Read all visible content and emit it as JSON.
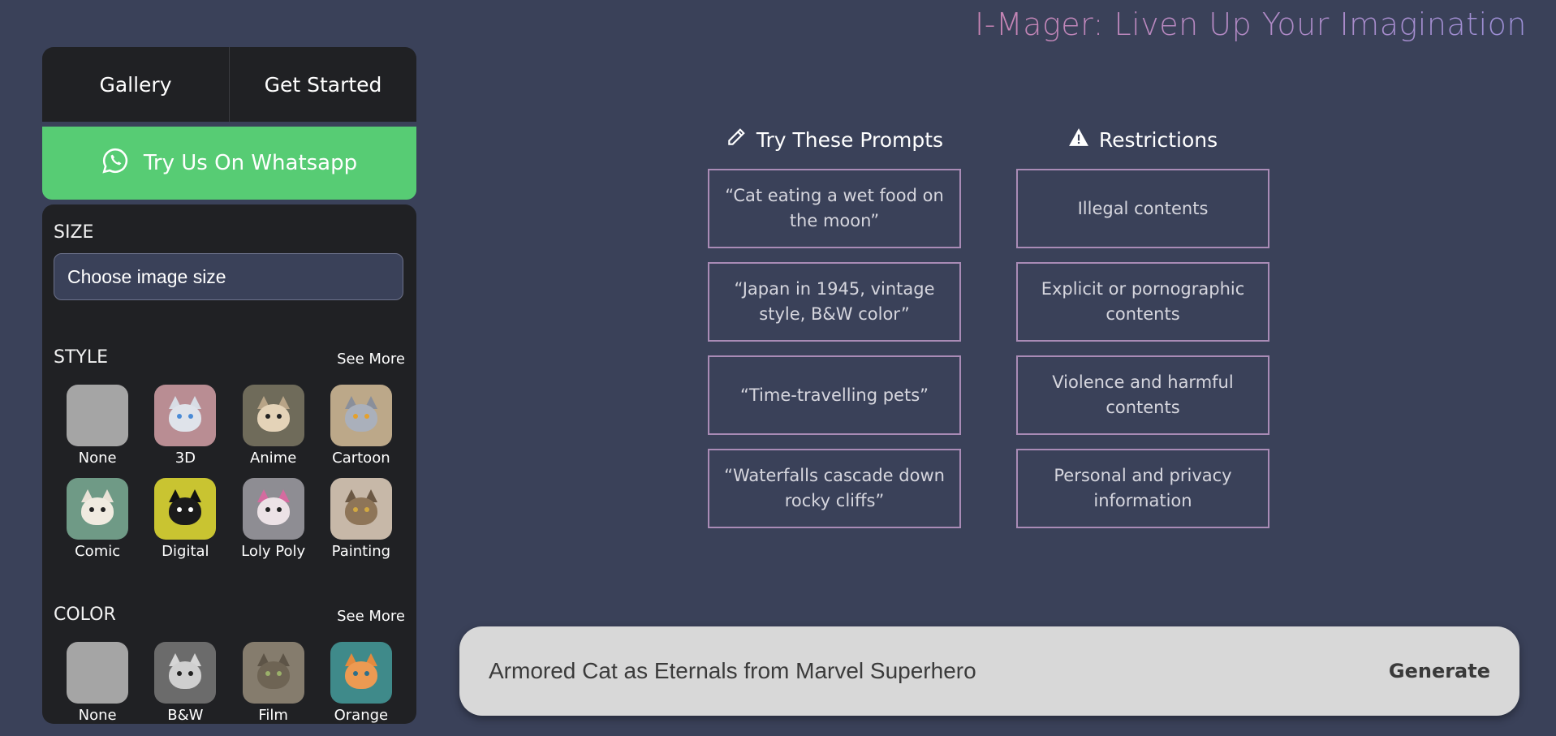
{
  "header": {
    "title": "I-Mager: Liven Up Your Imagination"
  },
  "nav": {
    "gallery": "Gallery",
    "get_started": "Get Started"
  },
  "whatsapp": {
    "label": "Try Us On Whatsapp",
    "color": "#57cc74"
  },
  "size": {
    "label": "SIZE",
    "placeholder": "Choose image size"
  },
  "style": {
    "label": "STYLE",
    "see_more": "See More",
    "items": [
      {
        "label": "None",
        "icon": "blank-thumbnail"
      },
      {
        "label": "3D",
        "icon": "3d-cat-thumbnail"
      },
      {
        "label": "Anime",
        "icon": "anime-cat-thumbnail"
      },
      {
        "label": "Cartoon",
        "icon": "cartoon-cat-thumbnail"
      },
      {
        "label": "Comic",
        "icon": "comic-cat-thumbnail"
      },
      {
        "label": "Digital",
        "icon": "digital-cat-thumbnail"
      },
      {
        "label": "Loly Poly",
        "icon": "loly-poly-cat-thumbnail"
      },
      {
        "label": "Painting",
        "icon": "painting-cat-thumbnail"
      }
    ]
  },
  "color": {
    "label": "COLOR",
    "see_more": "See More",
    "items": [
      {
        "label": "None",
        "icon": "blank-thumbnail"
      },
      {
        "label": "B&W",
        "icon": "bw-cat-thumbnail"
      },
      {
        "label": "Film",
        "icon": "film-cat-thumbnail"
      },
      {
        "label": "Orange",
        "icon": "orange-cat-thumbnail"
      }
    ]
  },
  "prompts": {
    "heading": "Try These Prompts",
    "icon": "pencil-icon",
    "items": [
      "“Cat eating a wet food on the moon”",
      "“Japan in 1945, vintage style, B&W color”",
      "“Time-travelling pets”",
      "“Waterfalls cascade down rocky cliffs”"
    ]
  },
  "restrictions": {
    "heading": "Restrictions",
    "icon": "warning-icon",
    "items": [
      "Illegal contents",
      "Explicit or pornographic contents",
      "Violence and harmful contents",
      "Personal and privacy information"
    ]
  },
  "prompt_bar": {
    "value": "Armored Cat as Eternals from Marvel Superhero",
    "generate": "Generate"
  },
  "colors": {
    "background": "#3a4159",
    "panel": "#202124",
    "card_border": "#a98bb6",
    "title_gradient_start": "#c784b3",
    "title_gradient_end": "#9b8fd6"
  }
}
